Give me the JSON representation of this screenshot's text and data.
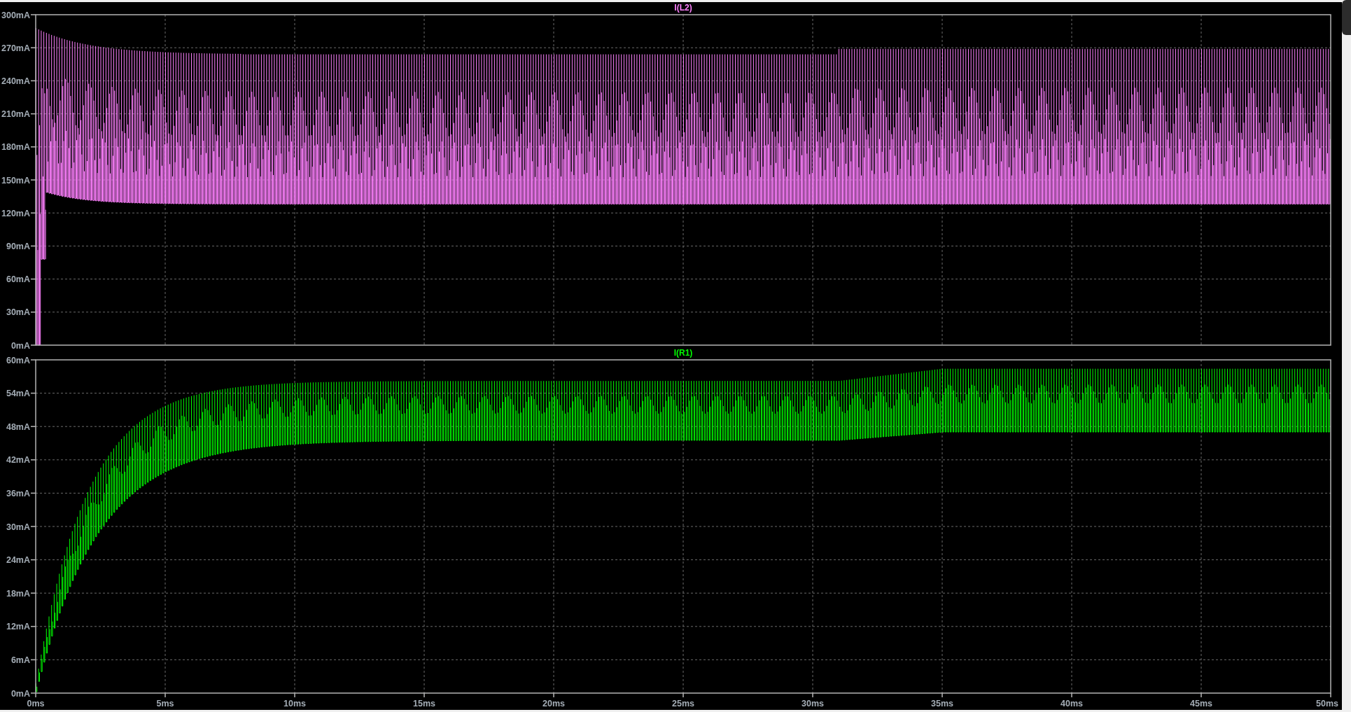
{
  "panes": [
    {
      "title": "I(L2)",
      "color": "#ff80ff",
      "y_ticks": [
        "300mA",
        "270mA",
        "240mA",
        "210mA",
        "180mA",
        "150mA",
        "120mA",
        "90mA",
        "60mA",
        "30mA",
        "0mA"
      ]
    },
    {
      "title": "I(R1)",
      "color": "#00ff00",
      "y_ticks": [
        "60mA",
        "54mA",
        "48mA",
        "42mA",
        "36mA",
        "30mA",
        "24mA",
        "18mA",
        "12mA",
        "6mA",
        "0mA"
      ]
    }
  ],
  "x_axis": {
    "ticks": [
      "0ms",
      "5ms",
      "10ms",
      "15ms",
      "20ms",
      "25ms",
      "30ms",
      "35ms",
      "40ms",
      "45ms",
      "50ms"
    ]
  }
}
